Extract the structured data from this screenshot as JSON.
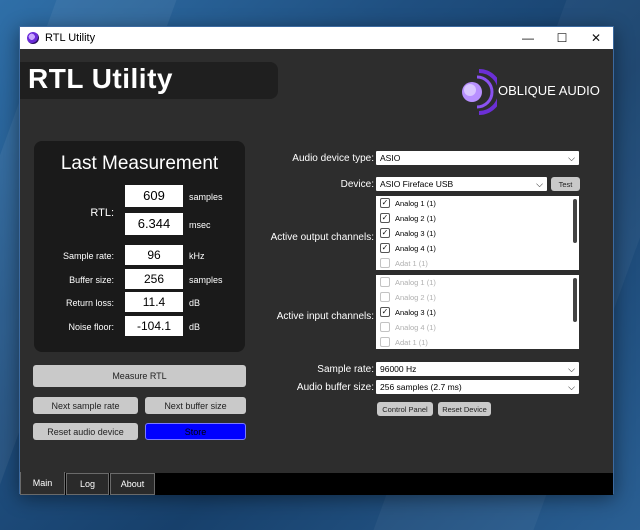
{
  "window": {
    "title": "RTL Utility",
    "controls": {
      "minimize": "—",
      "maximize": "☐",
      "close": "✕"
    }
  },
  "logo": {
    "title": "RTL Utility"
  },
  "brand": {
    "name": "OBLIQUE AUDIO"
  },
  "measurement": {
    "title": "Last Measurement",
    "rtl_label": "RTL:",
    "rtl_samples": "609",
    "rtl_samples_unit": "samples",
    "rtl_msec": "6.344",
    "rtl_msec_unit": "msec",
    "rows": [
      {
        "label": "Sample rate:",
        "value": "96",
        "unit": "kHz"
      },
      {
        "label": "Buffer size:",
        "value": "256",
        "unit": "samples"
      },
      {
        "label": "Return loss:",
        "value": "11.4",
        "unit": "dB"
      },
      {
        "label": "Noise floor:",
        "value": "-104.1",
        "unit": "dB"
      }
    ]
  },
  "buttons": {
    "measure": "Measure RTL",
    "next_sample_rate": "Next sample rate",
    "next_buffer_size": "Next buffer size",
    "reset_audio_device": "Reset audio device",
    "store": "Store",
    "control_panel": "Control Panel",
    "reset_device": "Reset Device",
    "test": "Test"
  },
  "settings": {
    "device_type_label": "Audio device type:",
    "device_type_value": "ASIO",
    "device_label": "Device:",
    "device_value": "ASIO Fireface USB",
    "output_label": "Active output channels:",
    "input_label": "Active input channels:",
    "sample_rate_label": "Sample rate:",
    "sample_rate_value": "96000 Hz",
    "buffer_label": "Audio buffer size:",
    "buffer_value": "256 samples (2.7 ms)"
  },
  "output_channels": [
    {
      "label": "Analog 1 (1)",
      "checked": true,
      "enabled": true
    },
    {
      "label": "Analog 2 (1)",
      "checked": true,
      "enabled": true
    },
    {
      "label": "Analog 3 (1)",
      "checked": true,
      "enabled": true
    },
    {
      "label": "Analog 4 (1)",
      "checked": true,
      "enabled": true
    },
    {
      "label": "Adat 1 (1)",
      "checked": false,
      "enabled": false
    }
  ],
  "input_channels": [
    {
      "label": "Analog 1 (1)",
      "checked": false,
      "enabled": false
    },
    {
      "label": "Analog 2 (1)",
      "checked": false,
      "enabled": false
    },
    {
      "label": "Analog 3 (1)",
      "checked": true,
      "enabled": true
    },
    {
      "label": "Analog 4 (1)",
      "checked": false,
      "enabled": false
    },
    {
      "label": "Adat 1 (1)",
      "checked": false,
      "enabled": false
    }
  ],
  "tabs": [
    {
      "label": "Main",
      "active": true
    },
    {
      "label": "Log",
      "active": false
    },
    {
      "label": "About",
      "active": false
    }
  ],
  "colors": {
    "accent_store": "#0000ff",
    "panel_bg": "#1a1a1a",
    "window_bg": "#2d2d2d"
  },
  "icons": {
    "app": "oblique-audio-swirl-icon",
    "dropdown": "chevron-down-icon",
    "check": "checkmark-icon"
  }
}
